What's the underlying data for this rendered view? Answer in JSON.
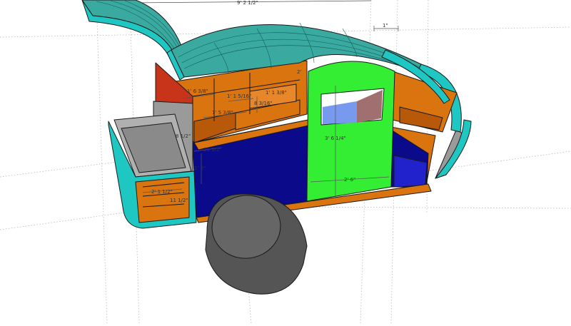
{
  "drawing": {
    "colors": {
      "shell": "#1fc7c2",
      "shell_dark": "#0e8f8b",
      "roof": "#3aa9a0",
      "wood": "#d9740f",
      "wood_dark": "#b8590a",
      "blue": "#0a0a8a",
      "door": "#33ee33",
      "tire": "#555555",
      "grey": "#9a9a9a",
      "red": "#c8341a"
    },
    "dimensions": [
      {
        "id": "overall-length",
        "text": "9' 2 1/2\""
      },
      {
        "id": "roof-overhang",
        "text": "1\""
      },
      {
        "id": "upper-cabinet-width",
        "text": "1' 6 3/8\""
      },
      {
        "id": "shelf-depth",
        "text": "1' 1 5/16\""
      },
      {
        "id": "shelf-small",
        "text": "1' 1 3/8\""
      },
      {
        "id": "cabinet-height",
        "text": "8 3/16\""
      },
      {
        "id": "lower-cabinet-width",
        "text": "1' 5 3/8\""
      },
      {
        "id": "side-gap",
        "text": "8 1/2\""
      },
      {
        "id": "galley-depth",
        "text": "11 1/2\""
      },
      {
        "id": "body-height",
        "text": "1' 2\""
      },
      {
        "id": "door-height",
        "text": "3' 6 1/4\""
      },
      {
        "id": "door-width",
        "text": "2' 6\""
      },
      {
        "id": "box-width",
        "text": "2' 1 1/2\""
      },
      {
        "id": "box-height",
        "text": "11 1/2\""
      },
      {
        "id": "roof-right",
        "text": "2'"
      }
    ]
  }
}
